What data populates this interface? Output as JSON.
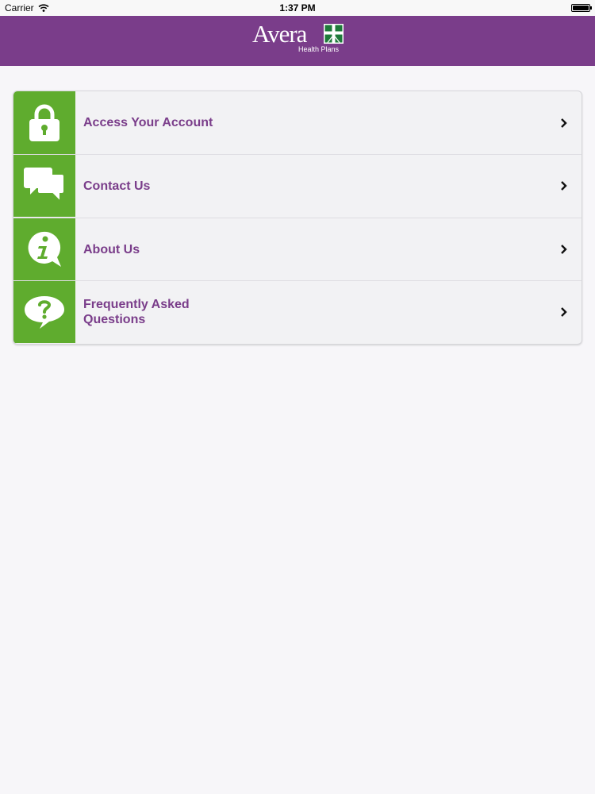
{
  "status_bar": {
    "carrier": "Carrier",
    "time": "1:37 PM"
  },
  "header": {
    "logo_text": "Avera",
    "logo_subtitle": "Health Plans",
    "background": "#7a3d8a"
  },
  "menu": {
    "accent": "#5fac2e",
    "label_color": "#7a3d8a",
    "items": [
      {
        "label": "Access Your Account",
        "icon": "lock-icon"
      },
      {
        "label": "Contact Us",
        "icon": "speech-bubbles-icon"
      },
      {
        "label": "About Us",
        "icon": "info-bubble-icon"
      },
      {
        "label_line1": "Frequently Asked",
        "label_line2": "Questions",
        "icon": "question-bubble-icon"
      }
    ]
  }
}
